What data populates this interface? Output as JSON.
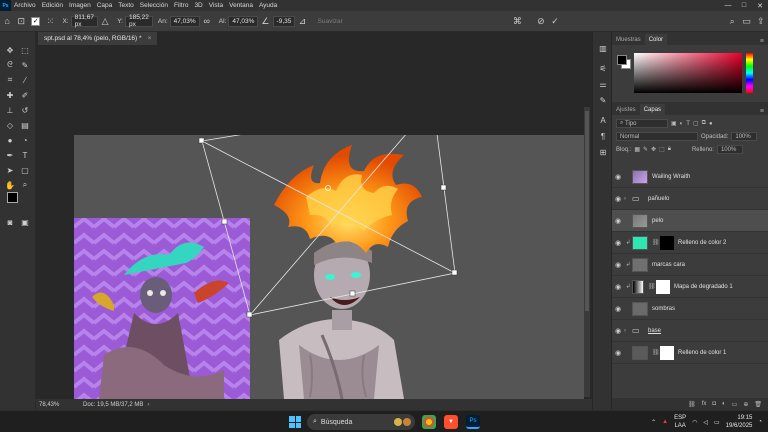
{
  "menubar": {
    "items": [
      "Archivo",
      "Edición",
      "Imagen",
      "Capa",
      "Texto",
      "Selección",
      "Filtro",
      "3D",
      "Vista",
      "Ventana",
      "Ayuda"
    ],
    "window_controls": [
      "—",
      "□",
      "✕"
    ]
  },
  "options": {
    "x_label": "X:",
    "x_value": "811,67 px",
    "y_label": "Y:",
    "y_value": "185,22 px",
    "w_label": "An:",
    "w_value": "47,03%",
    "h_label": "Al:",
    "h_value": "47,03%",
    "angle_value": "-9,35",
    "smooth_label": "Suavizar"
  },
  "document": {
    "tab_title": "spt.psd al 78,4% (pelo, RGB/16) *",
    "zoom": "78,43%",
    "doc_size": "Doc: 19,5 MB/37,2 MB"
  },
  "color_panel": {
    "tabs": [
      "Muestras",
      "Color"
    ],
    "active_tab": "Color"
  },
  "layers_panel": {
    "tabs": [
      "Ajustes",
      "Capas"
    ],
    "active_tab": "Capas",
    "filter_placeholder": "Tipo",
    "blend_mode": "Normal",
    "opacity_label": "Opacidad:",
    "opacity_value": "100%",
    "lock_label": "Bloq.:",
    "fill_label": "Relleno:",
    "fill_value": "100%",
    "layers": [
      {
        "name": "Wailing Wraith",
        "kind": "layer",
        "selected": false
      },
      {
        "name": "pañuelo",
        "kind": "group",
        "selected": false
      },
      {
        "name": "pelo",
        "kind": "layer",
        "selected": true
      },
      {
        "name": "Relleno de color 2",
        "kind": "fill",
        "selected": false
      },
      {
        "name": "marcas cara",
        "kind": "layer",
        "selected": false
      },
      {
        "name": "Mapa de degradado 1",
        "kind": "adjustment",
        "selected": false
      },
      {
        "name": "sombras",
        "kind": "layer",
        "selected": false
      },
      {
        "name": "base",
        "kind": "group",
        "selected": false
      },
      {
        "name": "Relleno de color 1",
        "kind": "fill",
        "selected": false
      }
    ]
  },
  "taskbar": {
    "search_label": "Búsqueda",
    "lang_top": "ESP",
    "lang_bottom": "LAA",
    "time": "19:15",
    "date": "19/6/2025"
  },
  "colors": {
    "teal_fill": "#2ee6b0",
    "accent_ps": "#31a8ff",
    "fire": "#ff8a00"
  }
}
